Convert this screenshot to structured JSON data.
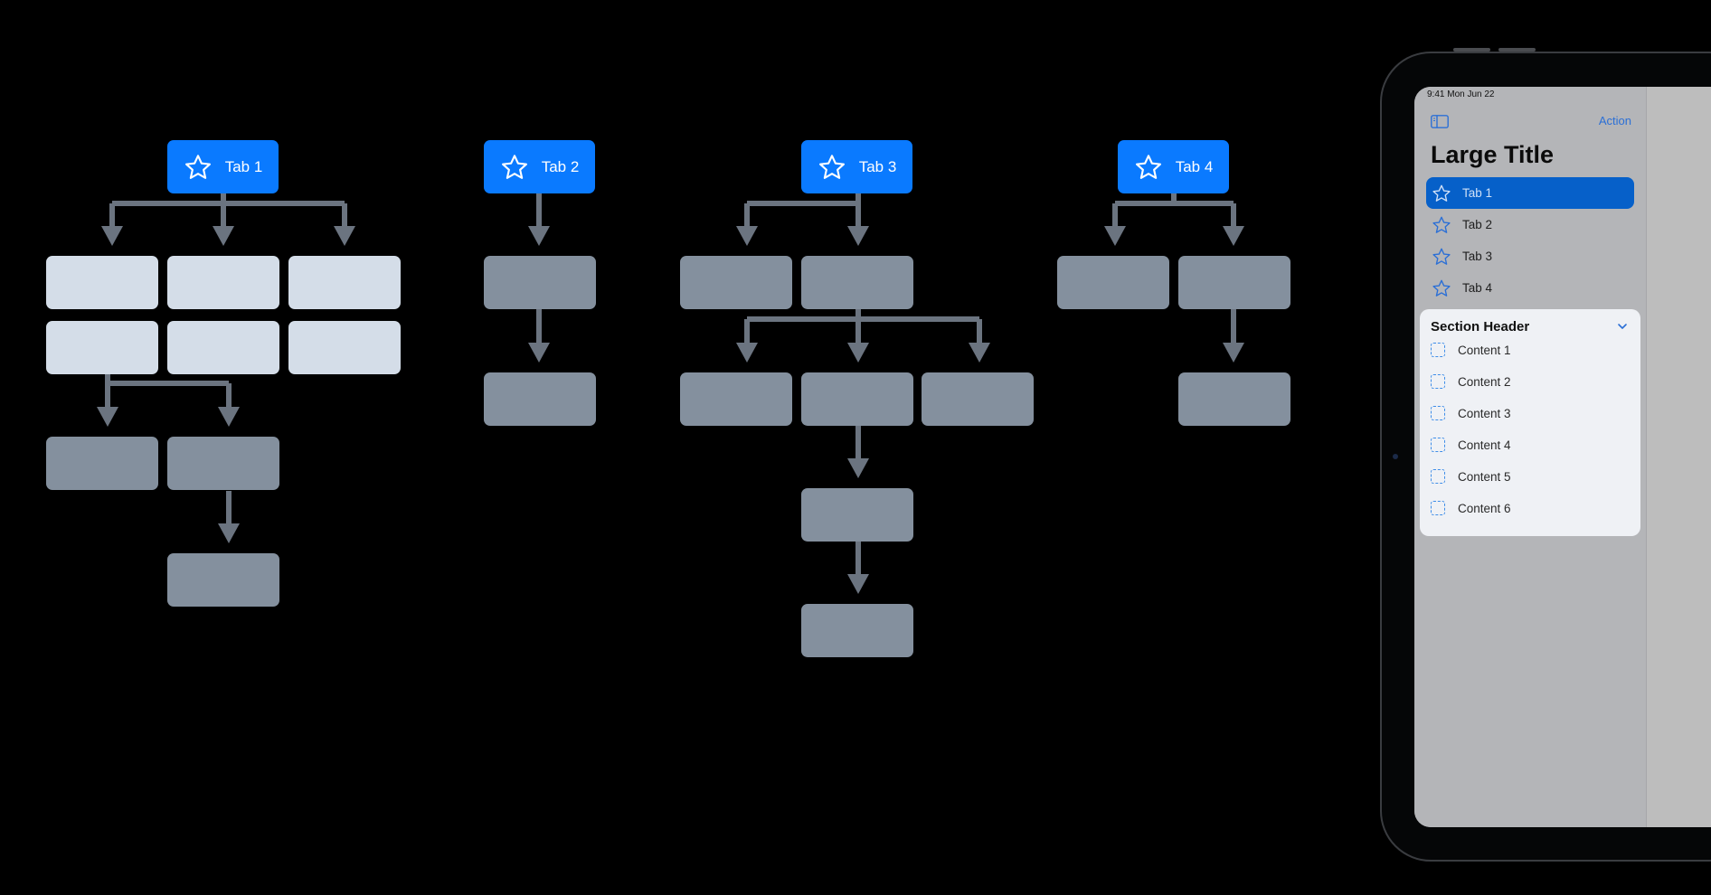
{
  "diagram": {
    "colors": {
      "tab_accent": "#0a7aff",
      "node": "#84909e",
      "node_highlight": "#d4dde8",
      "connector": "#6b7480",
      "background": "#000000"
    },
    "tabs": [
      {
        "label": "Tab 1",
        "icon": "star-icon",
        "tree": "3x2 grid of highlighted nodes; first-column second-row node branches to 2 nodes; right one leads to 1 more node"
      },
      {
        "label": "Tab 2",
        "icon": "star-icon",
        "tree": "linear chain of 2 nodes"
      },
      {
        "label": "Tab 3",
        "icon": "star-icon",
        "tree": "2 nodes; second branches to 3 nodes; middle one chains 2 deeper nodes"
      },
      {
        "label": "Tab 4",
        "icon": "star-icon",
        "tree": "2 nodes; second leads to 1 more node"
      }
    ]
  },
  "ipad": {
    "status_bar": "9:41  Mon Jun 22",
    "sidebar_toggle_icon": "sidebar-toggle-icon",
    "action_label": "Action",
    "large_title": "Large Title",
    "tabs": [
      {
        "label": "Tab 1",
        "icon": "star-icon",
        "selected": true
      },
      {
        "label": "Tab 2",
        "icon": "star-icon",
        "selected": false
      },
      {
        "label": "Tab 3",
        "icon": "star-icon",
        "selected": false
      },
      {
        "label": "Tab 4",
        "icon": "star-icon",
        "selected": false
      }
    ],
    "section": {
      "header": "Section Header",
      "expanded_icon": "chevron-down-icon",
      "items": [
        {
          "label": "Content 1",
          "icon": "dashed-square-icon"
        },
        {
          "label": "Content 2",
          "icon": "dashed-square-icon"
        },
        {
          "label": "Content 3",
          "icon": "dashed-square-icon"
        },
        {
          "label": "Content 4",
          "icon": "dashed-square-icon"
        },
        {
          "label": "Content 5",
          "icon": "dashed-square-icon"
        },
        {
          "label": "Content 6",
          "icon": "dashed-square-icon"
        }
      ]
    },
    "colors": {
      "selected_row": "#0660c9",
      "tint": "#2b6fd6",
      "sidebar_bg": "#b4b5b8",
      "detail_bg": "#bdbdbd",
      "card_bg": "#eff1f5"
    }
  }
}
